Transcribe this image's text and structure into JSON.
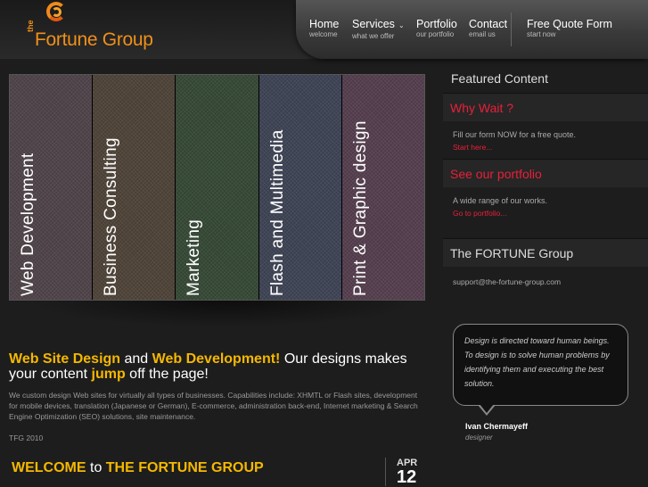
{
  "logo": {
    "prefix": "the",
    "name": "Fortune Group"
  },
  "nav": [
    {
      "label": "Home",
      "sub": "welcome"
    },
    {
      "label": "Services",
      "sub": "what we offer",
      "dropdown": true
    },
    {
      "label": "Portfolio",
      "sub": "our portfolio"
    },
    {
      "label": "Contact",
      "sub": "email us"
    },
    {
      "label": "Free Quote Form",
      "sub": "start now"
    }
  ],
  "banner": {
    "panels": [
      {
        "label": "Web Development",
        "color": "#4a3f44"
      },
      {
        "label": "Business Consulting",
        "color": "#4a3f34"
      },
      {
        "label": "Marketing",
        "color": "#324432"
      },
      {
        "label": "Flash and Multimedia",
        "color": "#3a3f50"
      },
      {
        "label": "Print & Graphic design",
        "color": "#503a4a"
      }
    ]
  },
  "sidebar": {
    "title": "Featured Content",
    "why_wait": {
      "heading": "Why Wait ?",
      "text": "Fill our form NOW for a free quote.",
      "link": "Start here..."
    },
    "portfolio": {
      "heading": "See our portfolio",
      "text": "A wide range of our works.",
      "link": "Go to portfolio..."
    },
    "group": {
      "heading": "The FORTUNE Group",
      "email": "support@the-fortune-group.com"
    }
  },
  "quote": {
    "text": "Design is directed toward human beings. To design is to solve human problems by identifying them and executing the best solution.",
    "author": "Ivan Chermayeff",
    "role": "designer"
  },
  "main": {
    "headline": {
      "p1": "Web Site Design",
      "p2": " and ",
      "p3": "Web Development!",
      "p4": " Our designs makes your content ",
      "p5": "jump",
      "p6": " off the page!"
    },
    "intro": "We custom design Web sites for virtually all types of businesses. Capabilities include: XHMTL or Flash sites, development for mobile devices, translation (Japanese or German), E-commerce, administration back-end, Internet marketing & Search Engine Optimization (SEO) solutions, site maintenance.",
    "tfg": "TFG 2010",
    "welcome": {
      "w1": "WELCOME",
      "w2": " to ",
      "w3": "THE FORTUNE GROUP"
    },
    "date": {
      "month": "APR",
      "day": "12"
    }
  }
}
